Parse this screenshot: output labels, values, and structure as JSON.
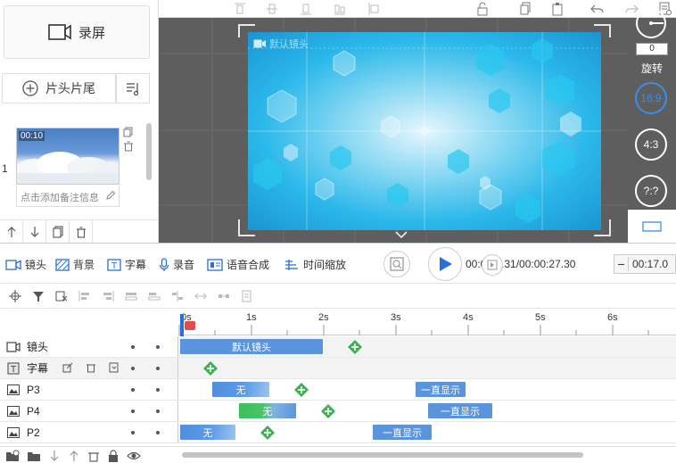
{
  "left": {
    "record_label": "录屏",
    "intro_label": "片头片尾",
    "scene_number": "1",
    "scene_time": "00:10",
    "scene_note": "点击添加备注信息"
  },
  "canvas": {
    "stage_label": "默认镜头"
  },
  "aspect": {
    "rotate_value": "0",
    "rotate_label": "旋转",
    "ratio_169": "16:9",
    "ratio_43": "4:3",
    "ratio_custom": "?:?"
  },
  "toolbar": {
    "lens": "镜头",
    "background": "背景",
    "subtitle": "字幕",
    "record_audio": "录音",
    "tts": "语音合成",
    "time_scale": "时间缩放",
    "time_readout": "00:0:00.31/00:00:27.30",
    "zoom_value": "00:17.0"
  },
  "timeline": {
    "ruler": [
      "0s",
      "1s",
      "2s",
      "3s",
      "4s",
      "5s",
      "6s"
    ],
    "tracks": [
      {
        "name": "镜头"
      },
      {
        "name": "字幕"
      },
      {
        "name": "P3"
      },
      {
        "name": "P4"
      },
      {
        "name": "P2"
      }
    ],
    "clips": {
      "lens_default": "默认镜头",
      "p3_none": "无",
      "p3_always": "一直显示",
      "p4_none": "无",
      "p4_always": "一直显示",
      "p2_none": "无",
      "p2_always": "一直显示"
    }
  },
  "colors": {
    "accent_blue": "#2a6fd6",
    "clip_blue": "#5a94dc",
    "clip_green": "#3bbf5a",
    "add_green": "#3fae55",
    "playhead_red": "#e14b4b"
  }
}
